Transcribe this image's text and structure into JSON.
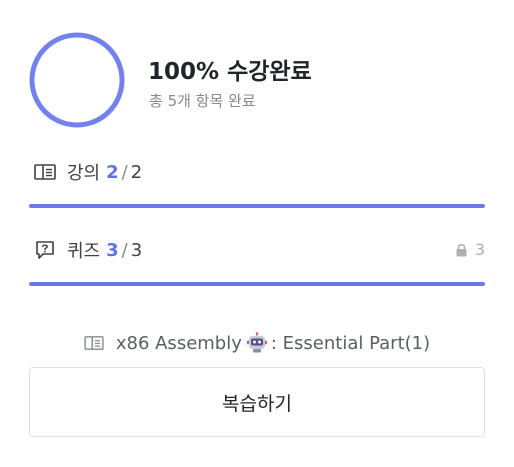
{
  "summary": {
    "title": "100% 수강완료",
    "subtitle": "총 5개 항목 완료",
    "progress_percent": 100,
    "ring_color": "#7381f0"
  },
  "lecture": {
    "label": "강의",
    "done": "2",
    "separator": "/",
    "total": "2",
    "progress_fraction": 1.0,
    "icon": "book-icon"
  },
  "quiz": {
    "label": "퀴즈",
    "done": "3",
    "separator": "/",
    "total": "3",
    "locked_count": "3",
    "progress_fraction": 1.0,
    "icon": "quiz-icon"
  },
  "lesson": {
    "title_part1": "x86 Assembly",
    "title_part2": ": Essential Part(1)",
    "icon": "book-icon",
    "emoji": "robot-icon"
  },
  "review_button": {
    "label": "복습하기"
  },
  "colors": {
    "accent": "#5f71e6",
    "bar": "#6b79e8",
    "text": "#212529",
    "muted": "#858a8d"
  }
}
